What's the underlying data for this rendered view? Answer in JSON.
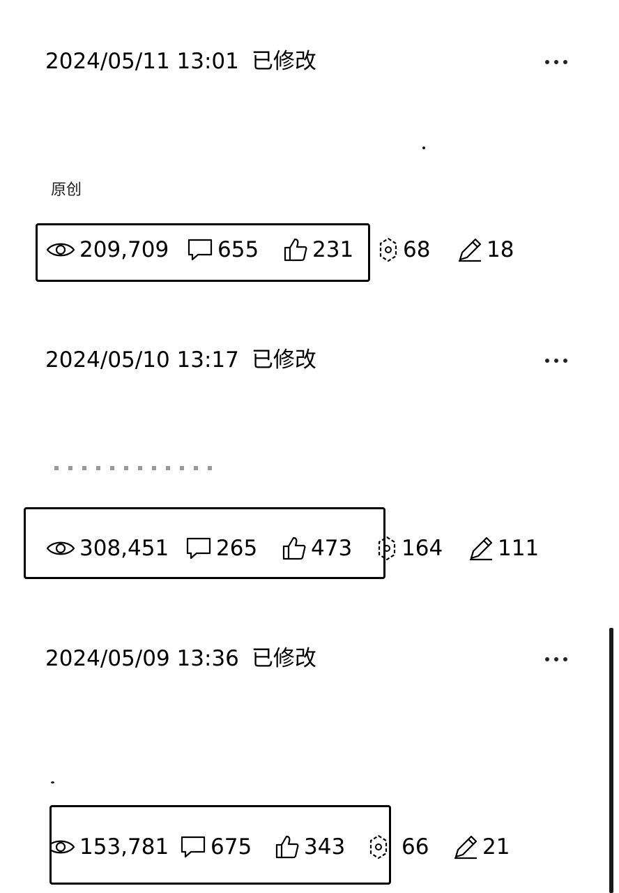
{
  "posts": [
    {
      "date": "2024/05/11 13:01",
      "modified": "已修改",
      "tag": "原创",
      "stats": {
        "views": "209,709",
        "comments": "655",
        "likes": "231",
        "shares": "68",
        "edits": "18"
      }
    },
    {
      "date": "2024/05/10 13:17",
      "modified": "已修改",
      "stats": {
        "views": "308,451",
        "comments": "265",
        "likes": "473",
        "shares": "164",
        "edits": "111"
      }
    },
    {
      "date": "2024/05/09 13:36",
      "modified": "已修改",
      "stats": {
        "views": "153,781",
        "comments": "675",
        "likes": "343",
        "shares": "66",
        "edits": "21"
      }
    }
  ],
  "icons": {
    "views": "eye-icon",
    "comments": "comment-icon",
    "likes": "thumbs-up-icon",
    "shares": "share-icon",
    "edits": "pencil-icon",
    "more": "more-dots-icon"
  }
}
